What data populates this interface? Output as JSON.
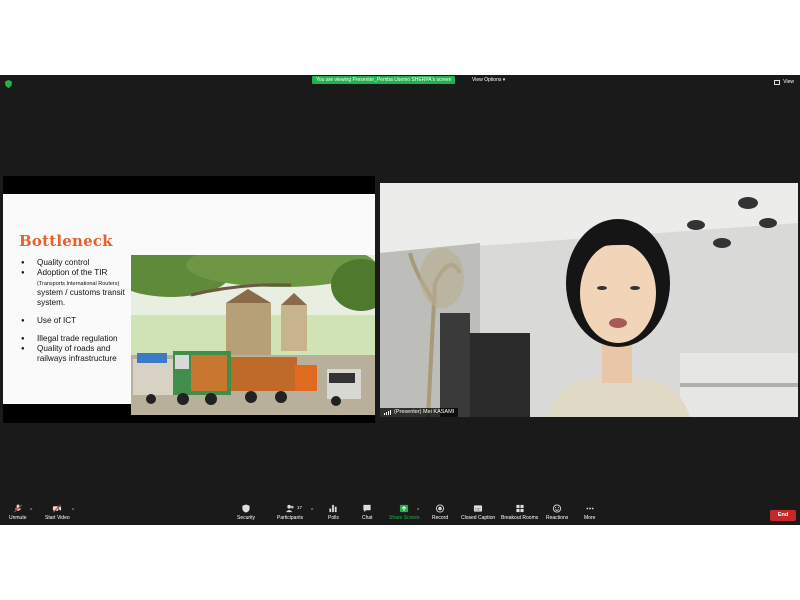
{
  "top_bar": {
    "viewing_banner": "You are viewing Presenter_Pemba Usemo SHERPA's screen",
    "view_options": "View Options",
    "view_button": "View"
  },
  "slide": {
    "title": "Bottleneck",
    "bullets": [
      {
        "text": "Quality control"
      },
      {
        "text_before": "Adoption of the TIR",
        "small": "(Transports International Routers)",
        "text_after": "system / customs transit system."
      },
      {
        "text": "Use of ICT"
      },
      {
        "text": "Illegal trade regulation"
      },
      {
        "text": "Quality of roads and railways infrastructure"
      }
    ]
  },
  "video": {
    "name_label": "(Presenter)  Mei KASAMI"
  },
  "toolbar": {
    "unmute": "Unmute",
    "start_video": "Start Video",
    "security": "Security",
    "participants": "Participants",
    "participants_count": "17",
    "polls": "Polls",
    "chat": "Chat",
    "share_screen": "Share Screen",
    "record": "Record",
    "closed_caption": "Closed Caption",
    "breakout_rooms": "Breakout Rooms",
    "reactions": "Reactions",
    "more": "More",
    "end": "End"
  },
  "colors": {
    "accent_green": "#22b14c",
    "end_red": "#c5282b",
    "title_orange": "#e8602c",
    "background": "#1a1a1a"
  }
}
